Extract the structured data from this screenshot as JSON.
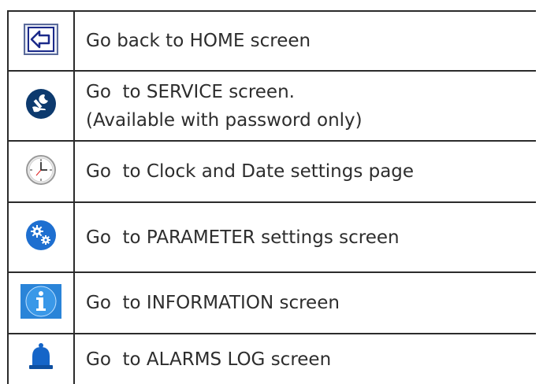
{
  "rows": [
    {
      "icon": "back-arrow-icon",
      "text": "Go back to HOME screen"
    },
    {
      "icon": "wrench-hand-icon",
      "text": "Go  to SERVICE screen.",
      "text2": "(Available with password only)"
    },
    {
      "icon": "clock-icon",
      "text": "Go  to Clock and Date settings page"
    },
    {
      "icon": "gears-icon",
      "text": "Go  to PARAMETER settings screen"
    },
    {
      "icon": "info-icon",
      "text": "Go  to INFORMATION screen"
    },
    {
      "icon": "bell-icon",
      "text": "Go  to ALARMS LOG screen"
    }
  ],
  "colors": {
    "border": "#2b2b2b",
    "text": "#2d2d2d",
    "accent_blue": "#1e6fd0",
    "dark_blue": "#0b3f78"
  }
}
